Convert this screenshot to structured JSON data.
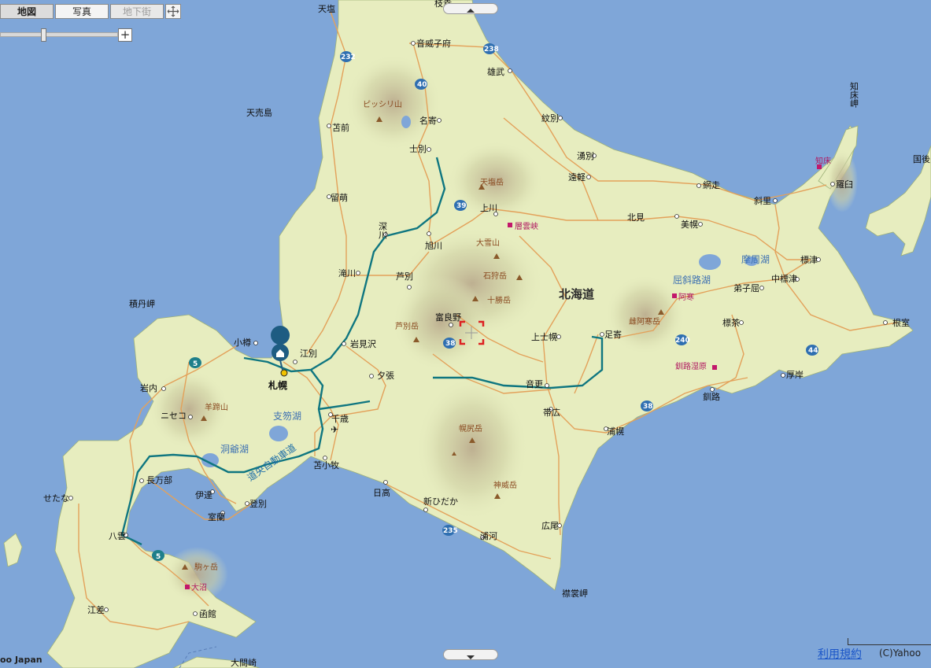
{
  "tabs": [
    {
      "label": "地図",
      "state": "active"
    },
    {
      "label": "写真",
      "state": "normal"
    },
    {
      "label": "地下街",
      "state": "disabled"
    }
  ],
  "colors": {
    "sea": "#7fa6d8",
    "land": "#e7edbf",
    "road": "#e3a15a",
    "expressway": "#0f7680",
    "peak": "#8a5a2b",
    "sightseeing": "#c2186b"
  },
  "places": {
    "wakkanai_area": "天塩",
    "esashi": "枝幸",
    "otoineppu": "音威子府",
    "omu": "雄武",
    "nayoro": "名寄",
    "shibetsu": "士別",
    "monbetsu": "紋別",
    "yubetsu": "湧別",
    "engaru": "遠軽",
    "abashiri": "網走",
    "shari": "斜里",
    "rausu": "羅臼",
    "kamikawa": "上川",
    "kitami": "北見",
    "bihoro": "美幌",
    "asahikawa": "旭川",
    "fukagawa": "深川",
    "rumoi": "留萌",
    "tomamae": "苫前",
    "takikawa": "滝川",
    "ashibetsu": "芦別",
    "furano": "富良野",
    "kamishihoro": "上士幌",
    "ashoro": "足寄",
    "teshikaga": "弟子屈",
    "shibecha": "標茶",
    "shibetsu_town": "標津",
    "nakashibetsu": "中標津",
    "nemuro": "根室",
    "akkeshi": "厚岸",
    "kushiro": "釧路",
    "obihiro": "帯広",
    "otofuke": "音更",
    "urahoro": "浦幌",
    "hiroo": "広尾",
    "urakawa": "浦河",
    "shinhidaka": "新ひだか",
    "hidaka": "日高",
    "tomakomai": "苫小牧",
    "chitose": "千歳",
    "yubari": "夕張",
    "iwamizawa": "岩見沢",
    "ebetsu": "江別",
    "sapporo": "札幌",
    "otaru": "小樽",
    "iwanai": "岩内",
    "niseko": "ニセコ",
    "oshamambe": "長万部",
    "date": "伊達",
    "muroran": "室蘭",
    "noboribetsu": "登別",
    "setana": "せたな",
    "yakumo": "八雲",
    "esashi_s": "江差",
    "hakodate": "函館",
    "oma": "大間崎",
    "hokkaido": "北海道",
    "teuri": "天売島",
    "shakotan": "積丹岬",
    "erimo": "襟裳岬",
    "shiretoko": "知床岬",
    "kunashiri": "国後"
  },
  "peaks": [
    "ピッシリ山",
    "天塩岳",
    "大雪山",
    "石狩岳",
    "十勝岳",
    "芦別岳",
    "雌阿寒岳",
    "羊蹄山",
    "幌尻岳",
    "神威岳",
    "駒ヶ岳"
  ],
  "sights": [
    "層雲峡",
    "阿寒",
    "釧路湿原",
    "知床",
    "大沼"
  ],
  "lakes": [
    "摩周湖",
    "屈斜路湖",
    "支笏湖",
    "洞爺湖"
  ],
  "expressway_label": "道央自動車道",
  "routes": [
    "232",
    "40",
    "238",
    "39",
    "38",
    "240",
    "44",
    "38",
    "235",
    "5",
    "5"
  ],
  "footer": {
    "left": "oo Japan",
    "terms": "利用規約",
    "copyright": "(C)Yahoo"
  }
}
